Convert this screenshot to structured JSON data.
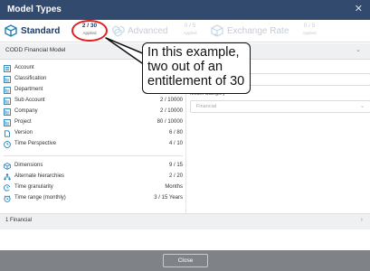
{
  "window": {
    "title": "Model Types",
    "close_glyph": "✕"
  },
  "tabs": [
    {
      "label": "Standard",
      "count": "2 / 30",
      "applied": "Applied",
      "icon": "cube-icon",
      "state": "active"
    },
    {
      "label": "Advanced",
      "count": "0 / 5",
      "applied": "Applied",
      "icon": "cubes-icon",
      "state": "disabled"
    },
    {
      "label": "Exchange Rate",
      "count": "0 / 5",
      "applied": "Applied",
      "icon": "exchange-cube-icon",
      "state": "disabled"
    }
  ],
  "model_header": {
    "title": "CODD Financial Model",
    "chevron": "⌄"
  },
  "dimensions": [
    {
      "label": "Account",
      "value": "",
      "icon": "list-icon"
    },
    {
      "label": "Classification",
      "value": "",
      "icon": "hierarchy-icon"
    },
    {
      "label": "Department",
      "value": "",
      "icon": "hierarchy-icon"
    },
    {
      "label": "Sub Account",
      "value": "2 / 10000",
      "icon": "hierarchy-icon"
    },
    {
      "label": "Company",
      "value": "2 / 10000",
      "icon": "hierarchy-icon"
    },
    {
      "label": "Project",
      "value": "80 / 10000",
      "icon": "hierarchy-icon"
    },
    {
      "label": "Version",
      "value": "6 / 80",
      "icon": "version-icon"
    },
    {
      "label": "Time Perspective",
      "value": "4 / 10",
      "icon": "clock-icon"
    }
  ],
  "summary": [
    {
      "label": "Dimensions",
      "value": "9 / 15",
      "icon": "cube-icon"
    },
    {
      "label": "Alternate hierarchies",
      "value": "2 / 20",
      "icon": "tree-icon"
    },
    {
      "label": "Time granularity",
      "value": "Months",
      "icon": "clock-arrow-icon"
    },
    {
      "label": "Time range (monthly)",
      "value": "3 / 15  Years",
      "icon": "clock-range-icon"
    }
  ],
  "right_panel": {
    "model_category_label": "Model Category",
    "model_category_value": "Financial",
    "dropdown_chevron": "⌄"
  },
  "annotation": {
    "text": "In this example, two out of an entitlement of 30"
  },
  "footer_section": {
    "title": "1 Financial",
    "chevron": "›"
  },
  "footer": {
    "close_label": "Close"
  },
  "colors": {
    "title_bar": "#324a6d",
    "accent": "#1f7fb8",
    "footer": "#7f8387",
    "callout_ring": "#e02020"
  }
}
